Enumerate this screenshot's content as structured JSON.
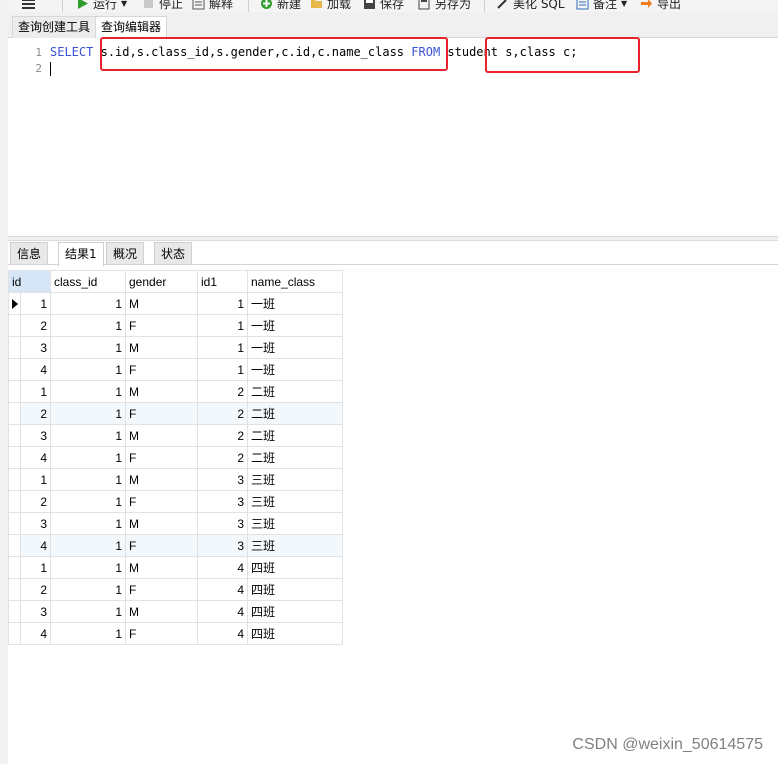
{
  "toolbar": {
    "items": [
      {
        "label": "",
        "icon": "hamburger-menu-icon"
      },
      {
        "label": "运行",
        "icon": "run-icon"
      },
      {
        "label": "停止",
        "icon": "stop-icon"
      },
      {
        "label": "解释",
        "icon": "explain-icon"
      },
      {
        "label": "新建",
        "icon": "new-icon"
      },
      {
        "label": "加载",
        "icon": "load-icon"
      },
      {
        "label": "保存",
        "icon": "save-icon"
      },
      {
        "label": "另存为",
        "icon": "save-as-icon"
      },
      {
        "label": "美化 SQL",
        "icon": "beautify-icon"
      },
      {
        "label": "备注",
        "icon": "comment-icon"
      },
      {
        "label": "导出",
        "icon": "export-icon"
      }
    ]
  },
  "editor_tabs": [
    "查询创建工具",
    "查询编辑器"
  ],
  "editor": {
    "line_numbers": [
      "1",
      "2"
    ],
    "sql": {
      "select_kw": "SELECT",
      "columns": "s.id,s.class_id,s.gender,c.id,c.name_class",
      "from_kw": "FROM",
      "tables": "student s,class c;"
    }
  },
  "colors": {
    "keyword": "#3a52d6",
    "highlight_box": "#e8232c",
    "selected_header": "#d7e6f7",
    "alt_row": "#f3f8fd"
  },
  "result_tabs": [
    "信息",
    "结果1",
    "概况",
    "状态"
  ],
  "result_grid": {
    "columns": [
      "id",
      "class_id",
      "gender",
      "id1",
      "name_class"
    ],
    "rows": [
      [
        "1",
        "1",
        "M",
        "1",
        "一班"
      ],
      [
        "2",
        "1",
        "F",
        "1",
        "一班"
      ],
      [
        "3",
        "1",
        "M",
        "1",
        "一班"
      ],
      [
        "4",
        "1",
        "F",
        "1",
        "一班"
      ],
      [
        "1",
        "1",
        "M",
        "2",
        "二班"
      ],
      [
        "2",
        "1",
        "F",
        "2",
        "二班"
      ],
      [
        "3",
        "1",
        "M",
        "2",
        "二班"
      ],
      [
        "4",
        "1",
        "F",
        "2",
        "二班"
      ],
      [
        "1",
        "1",
        "M",
        "3",
        "三班"
      ],
      [
        "2",
        "1",
        "F",
        "3",
        "三班"
      ],
      [
        "3",
        "1",
        "M",
        "3",
        "三班"
      ],
      [
        "4",
        "1",
        "F",
        "3",
        "三班"
      ],
      [
        "1",
        "1",
        "M",
        "4",
        "四班"
      ],
      [
        "2",
        "1",
        "F",
        "4",
        "四班"
      ],
      [
        "3",
        "1",
        "M",
        "4",
        "四班"
      ],
      [
        "4",
        "1",
        "F",
        "4",
        "四班"
      ]
    ]
  },
  "watermark": "CSDN @weixin_50614575"
}
